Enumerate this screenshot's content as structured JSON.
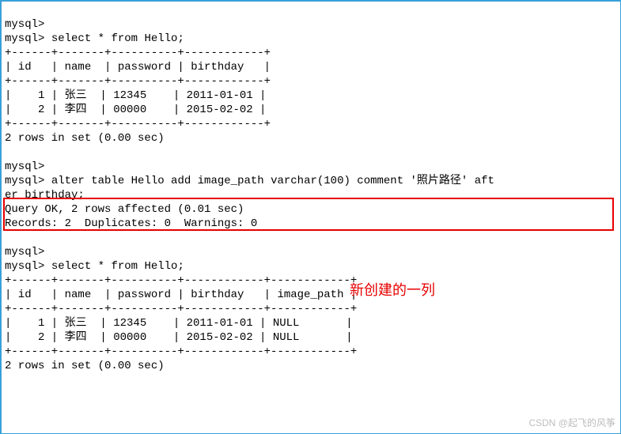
{
  "prompt": "mysql>",
  "cmd_select": "select * from Hello;",
  "cmd_alter_1": "alter table Hello add image_path varchar(100) comment '照片路径' aft",
  "cmd_alter_2": "er birthday;",
  "query_ok": "Query OK, 2 rows affected (0.01 sec)",
  "records_line": "Records: 2  Duplicates: 0  Warnings: 0",
  "rows_in_set": "2 rows in set (0.00 sec)",
  "table1": {
    "border_top": "+------+-------+----------+------------+",
    "header": "| id   | name  | password | birthday   |",
    "border_mid": "+------+-------+----------+------------+",
    "row1": "|    1 | 张三  | 12345    | 2011-01-01 |",
    "row2": "|    2 | 李四  | 00000    | 2015-02-02 |",
    "border_bot": "+------+-------+----------+------------+"
  },
  "table2": {
    "border_top": "+------+-------+----------+------------+------------+",
    "header": "| id   | name  | password | birthday   | image_path |",
    "border_mid": "+------+-------+----------+------------+------------+",
    "row1": "|    1 | 张三  | 12345    | 2011-01-01 | NULL       |",
    "row2": "|    2 | 李四  | 00000    | 2015-02-02 | NULL       |",
    "border_bot": "+------+-------+----------+------------+------------+"
  },
  "annotation": "新创建的一列",
  "watermark": "CSDN @起飞的风筝"
}
